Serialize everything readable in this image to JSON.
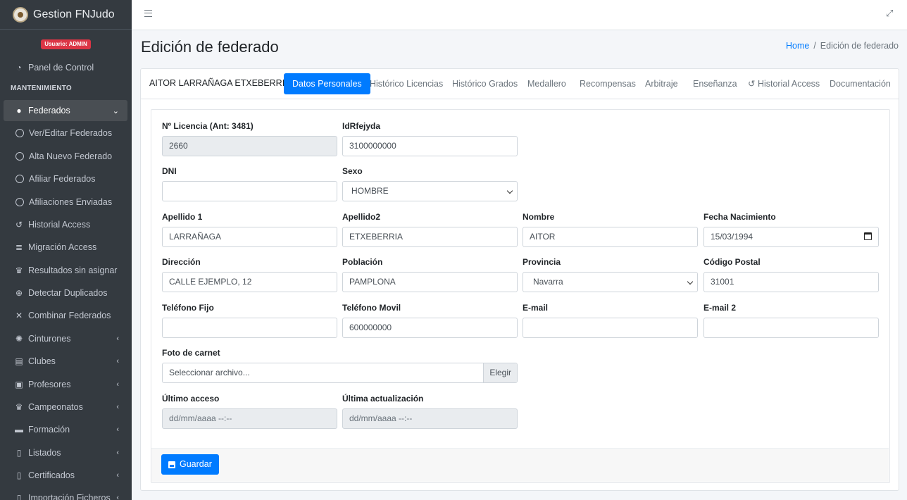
{
  "brand": {
    "title": "Gestion FNJudo"
  },
  "user": {
    "badge": "Usuario: ADMIN"
  },
  "sidebar": {
    "section_header": "MANTENIMIENTO",
    "items": [
      {
        "label": "Panel de Control",
        "icon": "dashboard-icon"
      },
      {
        "label": "Federados",
        "icon": "users-icon"
      },
      {
        "label": "Ver/Editar Federados",
        "icon": "circle-icon"
      },
      {
        "label": "Alta Nuevo Federado",
        "icon": "circle-icon"
      },
      {
        "label": "Afiliar Federados",
        "icon": "circle-icon"
      },
      {
        "label": "Afiliaciones Enviadas",
        "icon": "circle-icon"
      },
      {
        "label": "Historial Access",
        "icon": "history-icon"
      },
      {
        "label": "Migración Access",
        "icon": "database-icon"
      },
      {
        "label": "Resultados sin asignar",
        "icon": "trophy-icon"
      },
      {
        "label": "Detectar Duplicados",
        "icon": "search-plus-icon"
      },
      {
        "label": "Combinar Federados",
        "icon": "compress-icon"
      },
      {
        "label": "Cinturones",
        "icon": "cog-icon"
      },
      {
        "label": "Clubes",
        "icon": "building-icon"
      },
      {
        "label": "Profesores",
        "icon": "chalkboard-teacher-icon"
      },
      {
        "label": "Campeonatos",
        "icon": "trophy-icon"
      },
      {
        "label": "Formación",
        "icon": "book-icon"
      },
      {
        "label": "Listados",
        "icon": "list-icon"
      },
      {
        "label": "Certificados",
        "icon": "certificate-icon"
      },
      {
        "label": "Importación Ficheros",
        "icon": "file-import-icon"
      }
    ]
  },
  "page": {
    "title": "Edición de federado"
  },
  "breadcrumb": {
    "home": "Home",
    "current": "Edición de federado"
  },
  "card": {
    "federado_name": "AITOR LARRAÑAGA ETXEBERRIA",
    "tabs": [
      "Datos Personales",
      "Histórico Licencias",
      "Histórico Grados",
      "Medallero",
      "Recompensas",
      "Arbitraje",
      "Enseñanza",
      "Historial Access",
      "Documentación"
    ],
    "active_tab": "Datos Personales"
  },
  "form": {
    "licencia": {
      "label": "Nº Licencia (Ant: 3481)",
      "value": "2660"
    },
    "idrfejyda": {
      "label": "IdRfejyda",
      "value": "3100000000"
    },
    "dni": {
      "label": "DNI",
      "value": ""
    },
    "sexo": {
      "label": "Sexo",
      "value": "HOMBRE"
    },
    "apellido1": {
      "label": "Apellido 1",
      "value": "LARRAÑAGA"
    },
    "apellido2": {
      "label": "Apellido2",
      "value": "ETXEBERRIA"
    },
    "nombre": {
      "label": "Nombre",
      "value": "AITOR"
    },
    "fecha_nacimiento": {
      "label": "Fecha Nacimiento",
      "value": "15/03/1994"
    },
    "direccion": {
      "label": "Dirección",
      "value": "CALLE EJEMPLO, 12"
    },
    "poblacion": {
      "label": "Población",
      "value": "PAMPLONA"
    },
    "provincia": {
      "label": "Provincia",
      "value": "Navarra"
    },
    "codigo_postal": {
      "label": "Código Postal",
      "value": "31001"
    },
    "telefono_fijo": {
      "label": "Teléfono Fijo",
      "value": ""
    },
    "telefono_movil": {
      "label": "Teléfono Movil",
      "value": "600000000"
    },
    "email": {
      "label": "E-mail",
      "value": ""
    },
    "email2": {
      "label": "E-mail 2",
      "value": ""
    },
    "foto": {
      "label": "Foto de carnet",
      "placeholder": "Seleccionar archivo...",
      "button": "Elegir"
    },
    "ultimo_acceso": {
      "label": "Último acceso",
      "value": "dd/mm/aaaa --:--"
    },
    "ultima_actualizacion": {
      "label": "Última actualización",
      "value": "dd/mm/aaaa --:--"
    },
    "save_label": "Guardar"
  },
  "colors": {
    "primary": "#007bff",
    "sidebar_bg": "#343a40",
    "badge": "#dc3545"
  }
}
